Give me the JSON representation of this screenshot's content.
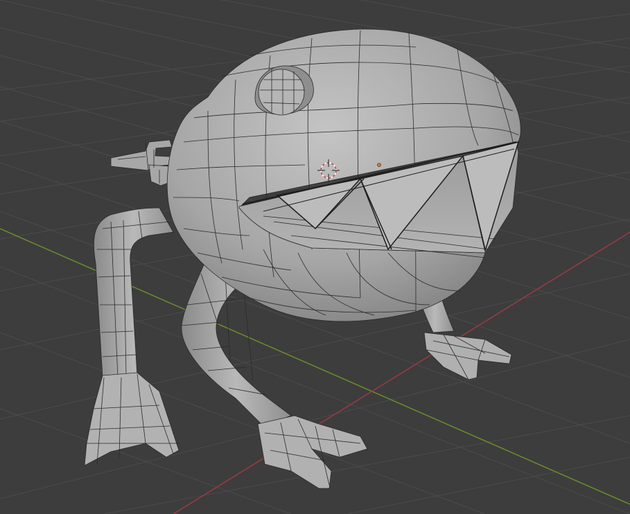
{
  "viewport": {
    "mode": "3d-viewport-wireframe-overlay",
    "background_color": "#3d3d3d",
    "grid_color": "#4a4a4a",
    "x_axis_color": "#9b3b44",
    "y_axis_color": "#6a8f2a",
    "mesh_fill_color": "#a9a9a9",
    "mesh_edge_color": "#262626",
    "cursor_color": "#d63c3c",
    "origin_color": "#e07a1f"
  },
  "object": {
    "icon": "creature-mesh-icon",
    "parts": [
      "body",
      "eye",
      "mouth-upper-teeth",
      "mouth-lower-jaw",
      "antenna-handle",
      "leg-front-left",
      "leg-front-right",
      "leg-back-right",
      "foot-front-left",
      "foot-front-right",
      "foot-back-right"
    ]
  },
  "overlays": {
    "cursor_icon": "3d-cursor-icon",
    "origin_icon": "object-origin-icon"
  }
}
